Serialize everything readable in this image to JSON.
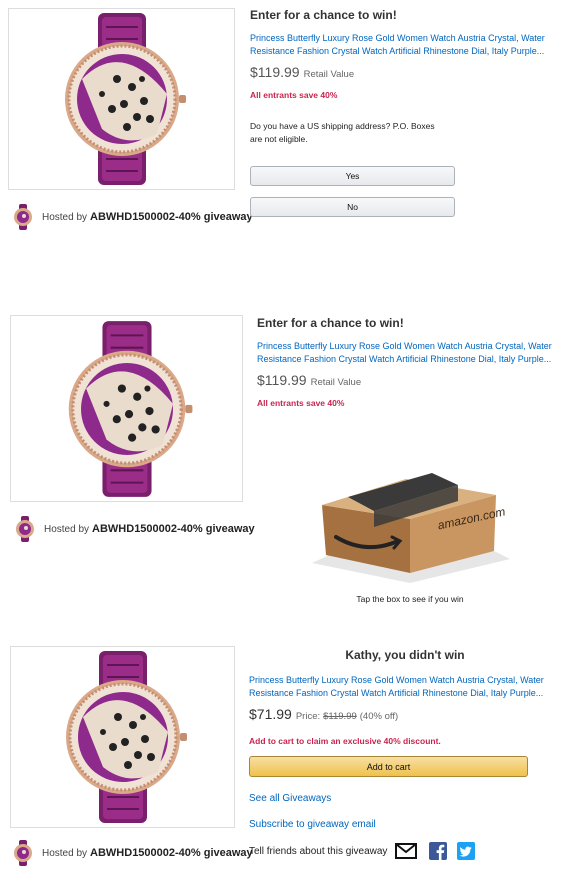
{
  "panel1": {
    "heading": "Enter for a chance to win!",
    "product_title_line1": "Princess Butterfly Luxury Rose Gold Women Watch Austria Crystal, Water",
    "product_title_line2": "Resistance Fashion Crystal Watch Artificial Rhinestone Dial, Italy Purple...",
    "price": "$119.99",
    "price_label": "Retail Value",
    "savings": "All entrants save 40%",
    "question_line1": "Do you have a US shipping address? P.O. Boxes",
    "question_line2": "are not eligible.",
    "yes_label": "Yes",
    "no_label": "No",
    "hosted_by": "Hosted by",
    "host_name": "ABWHD1500002-40% giveaway"
  },
  "panel2": {
    "heading": "Enter for a chance to win!",
    "product_title_line1": "Princess Butterfly Luxury Rose Gold Women Watch Austria Crystal, Water",
    "product_title_line2": "Resistance Fashion Crystal Watch Artificial Rhinestone Dial, Italy Purple...",
    "price": "$119.99",
    "price_label": "Retail Value",
    "savings": "All entrants save 40%",
    "box_brand": "amazon.com",
    "tap_text": "Tap the box to see if you win",
    "hosted_by": "Hosted by",
    "host_name": "ABWHD1500002-40% giveaway"
  },
  "panel3": {
    "heading": "Kathy, you didn't win",
    "product_title_line1": "Princess Butterfly Luxury Rose Gold Women Watch Austria Crystal, Water",
    "product_title_line2": "Resistance Fashion Crystal Watch Artificial Rhinestone Dial, Italy Purple...",
    "price": "$71.99",
    "price_prefix": "Price:",
    "old_price": "$119.99",
    "discount": "(40% off)",
    "claim_text": "Add to cart to claim an exclusive 40% discount.",
    "add_to_cart_label": "Add to cart",
    "see_all_label": "See all Giveaways",
    "subscribe_label": "Subscribe to giveaway email",
    "tell_friends": "Tell friends about this giveaway",
    "hosted_by": "Hosted by",
    "host_name": "ABWHD1500002-40% giveaway"
  },
  "icons": {
    "email": "email-icon",
    "facebook": "facebook-icon",
    "twitter": "twitter-icon"
  },
  "colors": {
    "link": "#0066c0",
    "savings": "#c7254e",
    "cart_button": "#f0c14b",
    "facebook": "#3b5998",
    "twitter": "#1da1f2"
  }
}
